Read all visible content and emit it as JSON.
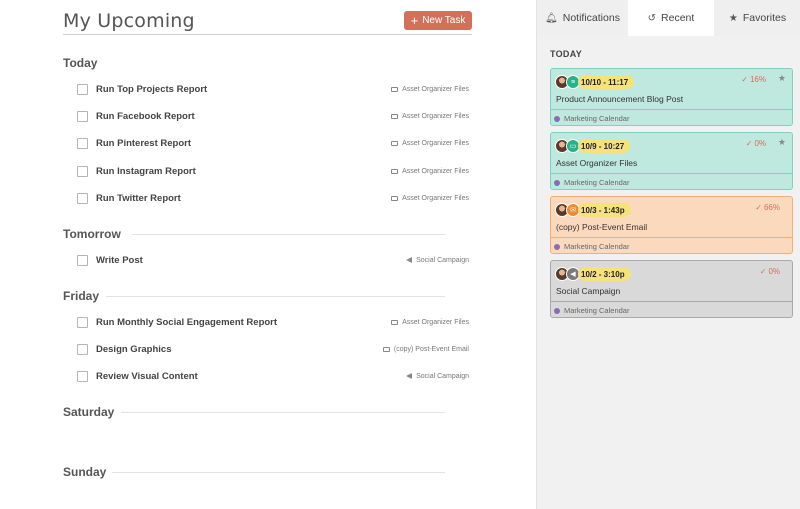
{
  "header": {
    "title": "My Upcoming",
    "new_task_label": "New Task"
  },
  "days": [
    {
      "label": "Today",
      "tasks": [
        {
          "name": "Run Top Projects Report",
          "link": "Asset Organizer Files",
          "link_icon": "folder-icon"
        },
        {
          "name": "Run Facebook Report",
          "link": "Asset Organizer Files",
          "link_icon": "folder-icon"
        },
        {
          "name": "Run Pinterest Report",
          "link": "Asset Organizer Files",
          "link_icon": "folder-icon"
        },
        {
          "name": "Run Instagram Report",
          "link": "Asset Organizer Files",
          "link_icon": "folder-icon"
        },
        {
          "name": "Run Twitter Report",
          "link": "Asset Organizer Files",
          "link_icon": "folder-icon"
        }
      ]
    },
    {
      "label": "Tomorrow",
      "tasks": [
        {
          "name": "Write Post",
          "link": "Social Campaign",
          "link_icon": "megaphone-icon"
        }
      ]
    },
    {
      "label": "Friday",
      "tasks": [
        {
          "name": "Run Monthly Social Engagement Report",
          "link": "Asset Organizer Files",
          "link_icon": "folder-icon"
        },
        {
          "name": "Design Graphics",
          "link": "(copy) Post-Event Email",
          "link_icon": "email-icon"
        },
        {
          "name": "Review Visual Content",
          "link": "Social Campaign",
          "link_icon": "megaphone-icon"
        }
      ]
    },
    {
      "label": "Saturday",
      "tasks": []
    },
    {
      "label": "Sunday",
      "tasks": []
    }
  ],
  "sidebar": {
    "tabs": [
      {
        "label": "Notifications",
        "icon": "bell-icon"
      },
      {
        "label": "Recent",
        "icon": "history-icon",
        "active": true
      },
      {
        "label": "Favorites",
        "icon": "star-icon"
      }
    ],
    "section_label": "TODAY",
    "cards": [
      {
        "date": "10/10 - 11:17",
        "progress": "16%",
        "title": "Product Announcement Blog Post",
        "calendar": "Marketing Calendar",
        "favorite": true,
        "type_icon": "rss-icon",
        "bg": "#bfe9df",
        "border": "#7fd2bf",
        "date_bg": "#f6e27a",
        "badge_bg": "#27b389"
      },
      {
        "date": "10/9 - 10:27",
        "progress": "0%",
        "title": "Asset Organizer Files",
        "calendar": "Marketing Calendar",
        "favorite": true,
        "type_icon": "folder-icon",
        "bg": "#bfe9df",
        "border": "#7fd2bf",
        "date_bg": "#f6e27a",
        "badge_bg": "#27b389"
      },
      {
        "date": "10/3 - 1:43p",
        "progress": "66%",
        "title": "(copy) Post-Event Email",
        "calendar": "Marketing Calendar",
        "favorite": false,
        "type_icon": "email-icon",
        "bg": "#fbd9bd",
        "border": "#f4ad73",
        "date_bg": "#f6e27a",
        "badge_bg": "#f08a2c"
      },
      {
        "date": "10/2 - 3:10p",
        "progress": "0%",
        "title": "Social Campaign",
        "calendar": "Marketing Calendar",
        "favorite": false,
        "type_icon": "megaphone-icon",
        "bg": "#d9d9d9",
        "border": "#a9a9a9",
        "date_bg": "#f6e27a",
        "badge_bg": "#7a7a7a"
      }
    ]
  },
  "colors": {
    "accent": "#d4705a",
    "calendar_dot": "#8b6bb8"
  }
}
